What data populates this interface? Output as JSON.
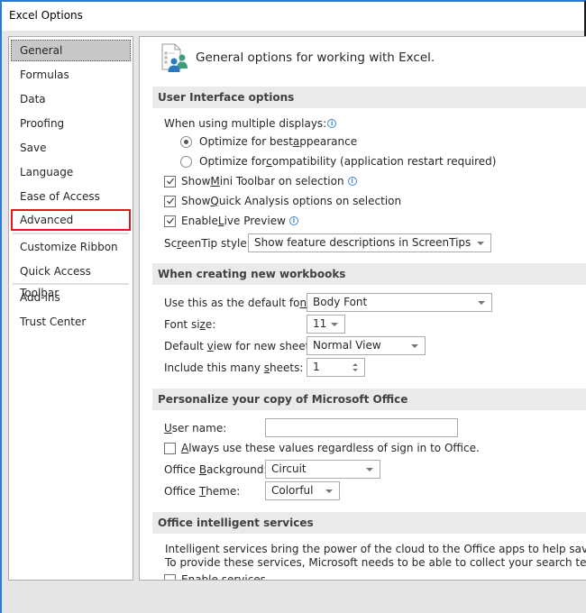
{
  "window": {
    "title": "Excel Options"
  },
  "sidebar": {
    "items": [
      {
        "label": "General",
        "selected": true
      },
      {
        "label": "Formulas"
      },
      {
        "label": "Data"
      },
      {
        "label": "Proofing"
      },
      {
        "label": "Save"
      },
      {
        "label": "Language"
      },
      {
        "label": "Ease of Access"
      },
      {
        "label": "Advanced",
        "highlighted": true
      },
      {
        "label": "Customize Ribbon"
      },
      {
        "label": "Quick Access Toolbar"
      },
      {
        "label": "Add-ins"
      },
      {
        "label": "Trust Center"
      }
    ]
  },
  "main": {
    "header": "General options for working with Excel.",
    "ui_options": {
      "title": "User Interface options",
      "multi_display_label": "When using multiple displays:",
      "radio_best": {
        "pre": "Optimize for best ",
        "u": "a",
        "post": "ppearance",
        "checked": true
      },
      "radio_compat": {
        "pre": "Optimize for ",
        "u": "c",
        "post": "ompatibility (application restart required)",
        "checked": false
      },
      "mini_toolbar": {
        "pre": "Show ",
        "u": "M",
        "post": "ini Toolbar on selection",
        "checked": true
      },
      "quick_analysis": {
        "pre": "Show ",
        "u": "Q",
        "post": "uick Analysis options on selection",
        "checked": true
      },
      "live_preview": {
        "pre": "Enable ",
        "u": "L",
        "post": "ive Preview",
        "checked": true
      },
      "screentip": {
        "pre": "Sc",
        "u": "r",
        "post": "eenTip style:",
        "value": "Show feature descriptions in ScreenTips"
      }
    },
    "new_workbooks": {
      "title": "When creating new workbooks",
      "default_font": {
        "pre": "Use this as the default fo",
        "u": "n",
        "post": "t:",
        "value": "Body Font"
      },
      "font_size": {
        "pre": "Font si",
        "u": "z",
        "post": "e:",
        "value": "11"
      },
      "default_view": {
        "pre": "Default ",
        "u": "v",
        "post": "iew for new sheets:",
        "value": "Normal View"
      },
      "sheets": {
        "pre": "Include this many ",
        "u": "s",
        "post": "heets:",
        "value": "1"
      }
    },
    "personalize": {
      "title": "Personalize your copy of Microsoft Office",
      "user_name": {
        "u": "U",
        "post": "ser name:",
        "value": ""
      },
      "always_use": {
        "u": "A",
        "post": "lways use these values regardless of sign in to Office.",
        "checked": false
      },
      "background": {
        "pre": "Office ",
        "u": "B",
        "post": "ackground:",
        "value": "Circuit"
      },
      "theme": {
        "pre": "Office ",
        "u": "T",
        "post": "heme:",
        "value": "Colorful"
      }
    },
    "intelligent": {
      "title": "Office intelligent services",
      "line1": "Intelligent services bring the power of the cloud to the Office apps to help save you time a",
      "line2": "To provide these services, Microsoft needs to be able to collect your search terms and do",
      "enable": {
        "label": "Enable services",
        "checked": false
      }
    }
  }
}
